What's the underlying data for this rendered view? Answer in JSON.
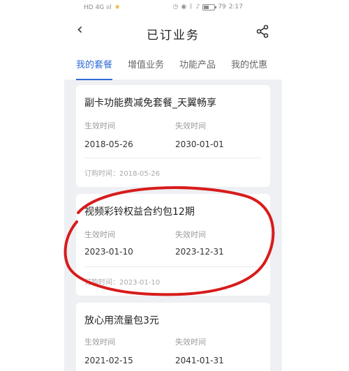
{
  "status": {
    "left_text": "HD 4G ııl",
    "time": "2:17",
    "battery": "79"
  },
  "header": {
    "title": "已订业务"
  },
  "tabs": [
    {
      "label": "我的套餐"
    },
    {
      "label": "增值业务"
    },
    {
      "label": "功能产品"
    },
    {
      "label": "我的优惠"
    }
  ],
  "labels": {
    "start": "生效时间",
    "end": "失效时间"
  },
  "cards": [
    {
      "name": "副卡功能费减免套餐_天翼畅享",
      "start": "2018-05-26",
      "end": "2030-01-01",
      "order": "订购时间：2018-05-26"
    },
    {
      "name": "视频彩铃权益合约包12期",
      "start": "2023-01-10",
      "end": "2023-12-31",
      "order": "订购时间：2023-01-10"
    },
    {
      "name": "放心用流量包3元",
      "start": "2021-02-15",
      "end": "2041-01-31",
      "order": ""
    }
  ],
  "colors": {
    "accent": "#2f6bd6",
    "annotation": "#d81b1b"
  }
}
